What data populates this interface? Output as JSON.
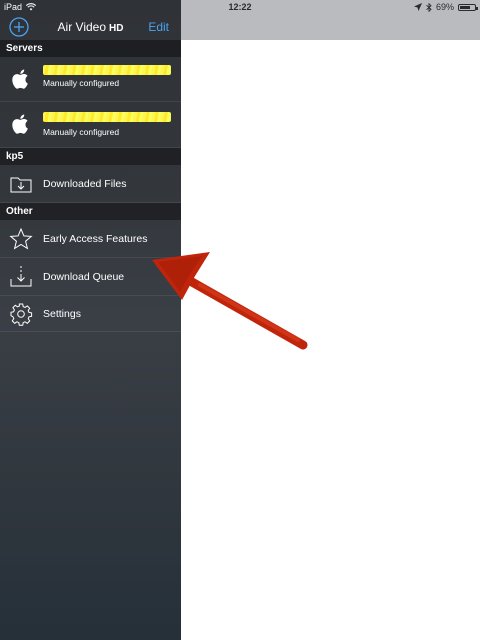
{
  "status_bar": {
    "device": "iPad",
    "time": "12:22",
    "battery": "69%",
    "battery_level": 0.69
  },
  "nav": {
    "title": "Air Video",
    "title_suffix": "HD",
    "edit_label": "Edit",
    "add_icon": "plus-circle-icon"
  },
  "sections": {
    "servers": "Servers",
    "kp5": "kp5",
    "other": "Other"
  },
  "servers": [
    {
      "name": "████████",
      "subtitle": "Manually configured",
      "icon": "apple-icon"
    },
    {
      "name": "████████",
      "subtitle": "Manually configured",
      "icon": "apple-icon"
    }
  ],
  "kp5_items": [
    {
      "label": "Downloaded Files",
      "icon": "folder-download-icon"
    }
  ],
  "other_items": [
    {
      "label": "Early Access Features",
      "icon": "star-icon"
    },
    {
      "label": "Download Queue",
      "icon": "download-queue-icon"
    },
    {
      "label": "Settings",
      "icon": "gear-icon"
    }
  ],
  "colors": {
    "accent": "#4aa3f0",
    "highlight": "#ffee33",
    "annotation_arrow": "#c0250c"
  }
}
